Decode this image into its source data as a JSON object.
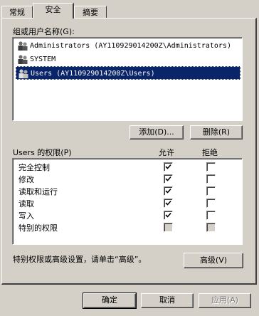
{
  "tabs": [
    {
      "label": "常规",
      "selected": false
    },
    {
      "label": "安全",
      "selected": true
    },
    {
      "label": "摘要",
      "selected": false
    }
  ],
  "group_label": "组或用户名称(G):",
  "users": [
    {
      "name": "Administrators (AY110929014200Z\\Administrators)",
      "selected": false
    },
    {
      "name": "SYSTEM",
      "selected": false
    },
    {
      "name": "Users (AY110929014200Z\\Users)",
      "selected": true
    }
  ],
  "buttons": {
    "add": "添加(D)...",
    "remove": "删除(R)",
    "advanced": "高级(V)",
    "ok": "确定",
    "cancel": "取消",
    "apply": "应用(A)"
  },
  "perm_header": {
    "label": "Users 的权限(P)",
    "allow": "允许",
    "deny": "拒绝"
  },
  "permissions": [
    {
      "name": "完全控制",
      "allow": true,
      "deny": false,
      "disabled": false
    },
    {
      "name": "修改",
      "allow": true,
      "deny": false,
      "disabled": false
    },
    {
      "name": "读取和运行",
      "allow": true,
      "deny": false,
      "disabled": false
    },
    {
      "name": "读取",
      "allow": true,
      "deny": false,
      "disabled": false
    },
    {
      "name": "写入",
      "allow": true,
      "deny": false,
      "disabled": false
    },
    {
      "name": "特别的权限",
      "allow": false,
      "deny": false,
      "disabled": true
    }
  ],
  "advanced_hint": "特别权限或高级设置，请单击“高级”。"
}
